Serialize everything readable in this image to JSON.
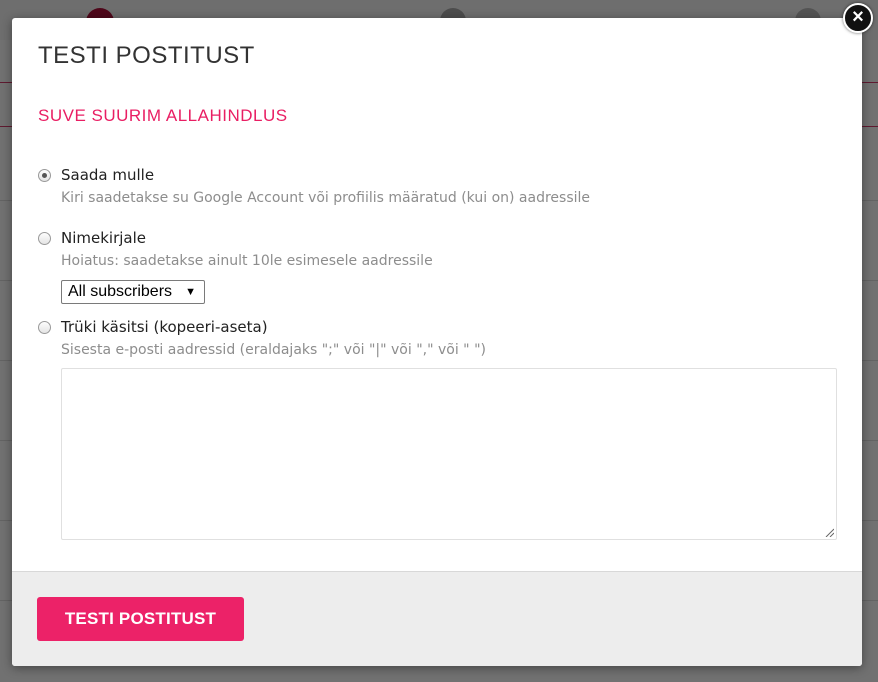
{
  "modal": {
    "title": "TESTI POSTITUST",
    "campaign_name": "SUVE SUURIM ALLAHINDLUS",
    "options": [
      {
        "label": "Saada mulle",
        "help": "Kiri saadetakse su Google Account või profiilis määratud (kui on) aadressile",
        "checked": true
      },
      {
        "label": "Nimekirjale",
        "help": "Hoiatus: saadetakse ainult 10le esimesele aadressile",
        "checked": false
      },
      {
        "label": "Trüki käsitsi (kopeeri-aseta)",
        "help": "Sisesta e-posti aadressid (eraldajaks \";\" või \"|\" või \",\" või \" \")",
        "checked": false
      }
    ],
    "list_select": {
      "selected": "All subscribers"
    },
    "emails_textarea": {
      "value": ""
    },
    "submit_label": "TESTI POSTITUST",
    "close_icon": "close-icon"
  },
  "colors": {
    "accent": "#ec2268",
    "campaign_text": "#e91e63",
    "footer_bg": "#ededed",
    "overlay": "rgba(0,0,0,0.55)"
  }
}
